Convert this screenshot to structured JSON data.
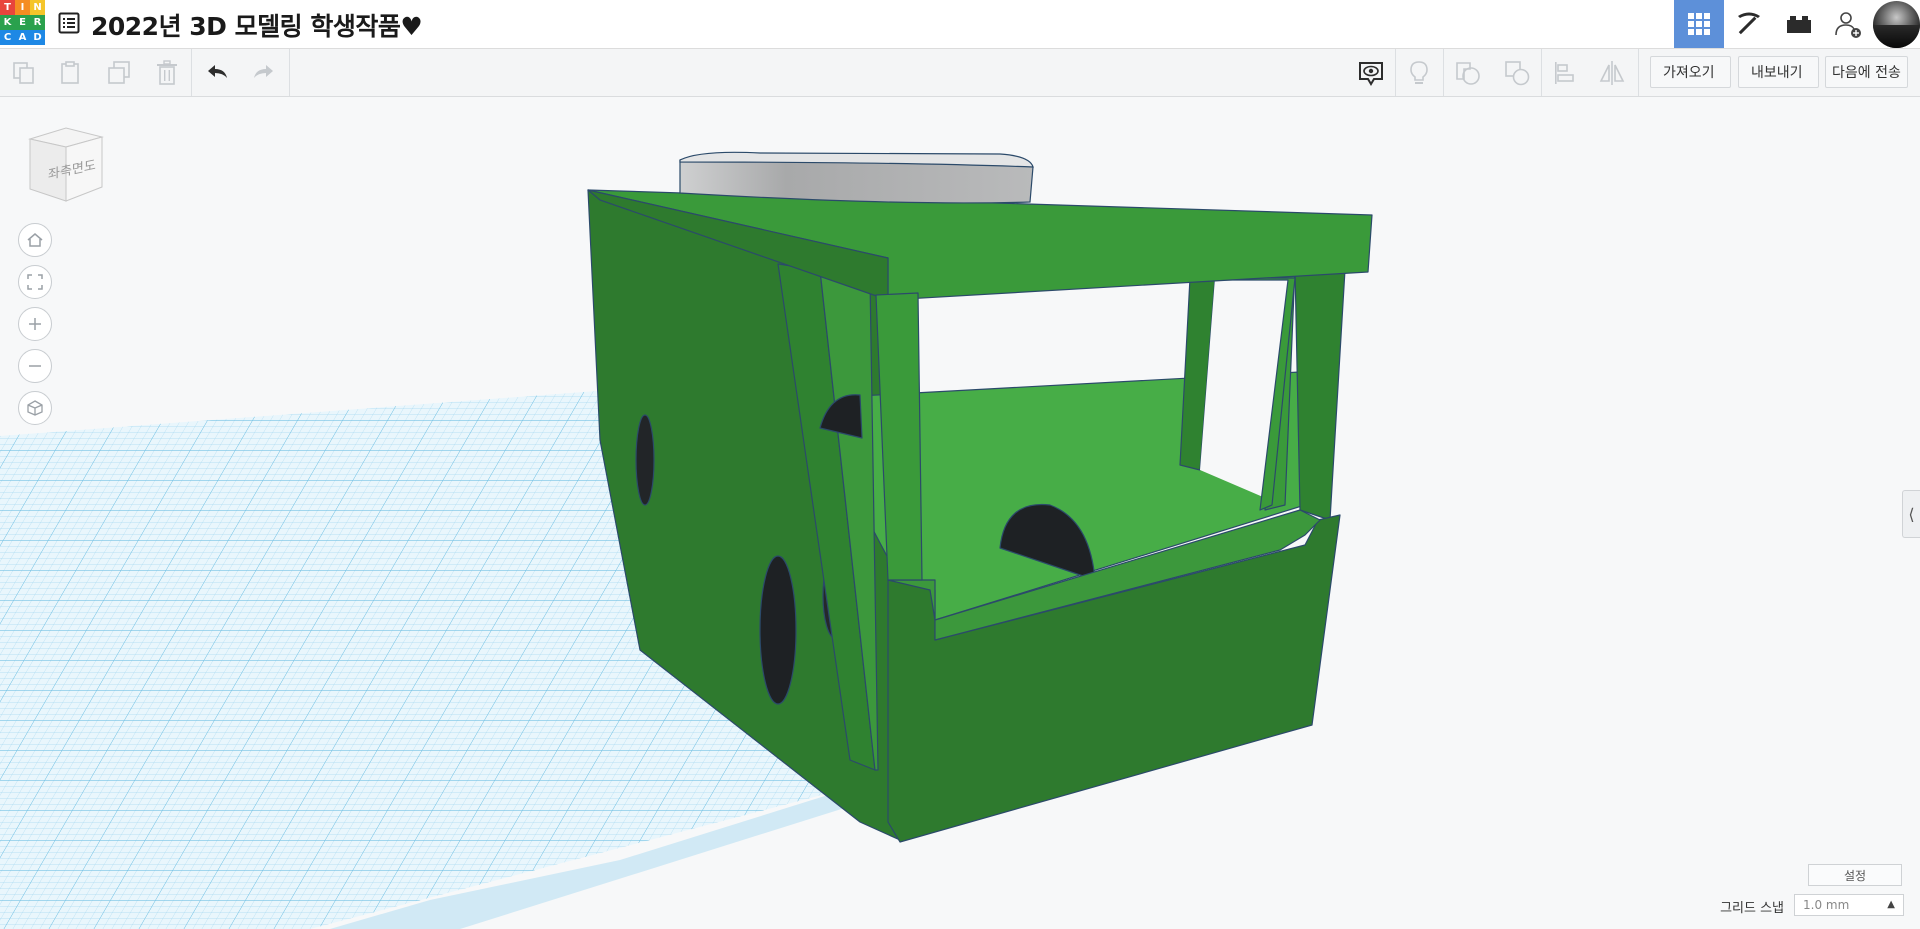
{
  "app": {
    "logo_letters": [
      "T",
      "I",
      "N",
      "K",
      "E",
      "R",
      "C",
      "A",
      "D"
    ],
    "logo_colors": [
      "#e8453c",
      "#f58d22",
      "#f5c52a",
      "#2aa14d",
      "#2aa14d",
      "#2aa14d",
      "#1e88e5",
      "#1e88e5",
      "#1e88e5"
    ],
    "design_title": "2022년 3D 모델링 학생작품♥",
    "accent_color": "#5d90d9"
  },
  "header": {
    "buttons": [
      {
        "name": "3d-design-view",
        "icon": "grid-icon",
        "active": true
      },
      {
        "name": "minecraft-view",
        "icon": "pickaxe-icon",
        "active": false
      },
      {
        "name": "lego-bricks-view",
        "icon": "brick-icon",
        "active": false
      },
      {
        "name": "add-collaborator",
        "icon": "add-user-icon",
        "active": false
      }
    ]
  },
  "toolbar": {
    "left_tools": [
      {
        "name": "copy",
        "icon": "copy-icon"
      },
      {
        "name": "paste",
        "icon": "paste-icon"
      },
      {
        "name": "duplicate",
        "icon": "duplicate-icon"
      },
      {
        "name": "delete",
        "icon": "trash-icon"
      },
      {
        "name": "undo",
        "icon": "undo-icon"
      },
      {
        "name": "redo",
        "icon": "redo-icon"
      }
    ],
    "right_tools": [
      {
        "name": "notes",
        "icon": "comment-eye-icon"
      },
      {
        "name": "show-all",
        "icon": "lightbulb-icon"
      },
      {
        "name": "group",
        "icon": "group-icon"
      },
      {
        "name": "ungroup",
        "icon": "ungroup-icon"
      },
      {
        "name": "align",
        "icon": "align-icon"
      },
      {
        "name": "mirror",
        "icon": "mirror-icon"
      }
    ],
    "import_label": "가져오기",
    "export_label": "내보내기",
    "send_to_label": "다음에 전송"
  },
  "workplane": {
    "viewcube_label": "좌측면도",
    "nav_buttons": [
      "home-icon",
      "fit-view-icon",
      "zoom-in-icon",
      "zoom-out-icon",
      "perspective-icon"
    ],
    "model_color": "#3a9a3a",
    "grid_color": "#8fd0ec"
  },
  "footer": {
    "settings_label": "설정",
    "grid_snap_label": "그리드 스냅",
    "grid_snap_value": "1.0 mm"
  }
}
